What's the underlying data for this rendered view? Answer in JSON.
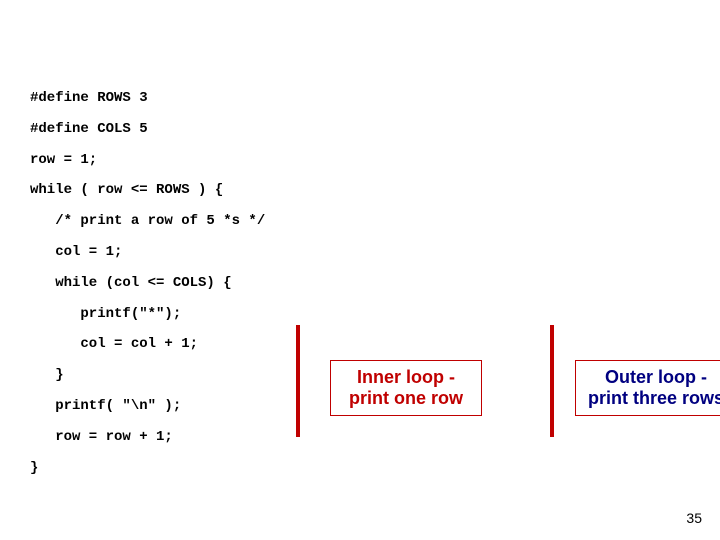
{
  "code": {
    "l1": "#define ROWS 3",
    "l2": "#define COLS 5",
    "l3": "row = 1;",
    "l4": "while ( row <= ROWS ) {",
    "l5": "   /* print a row of 5 *s */",
    "l6": "   col = 1;",
    "l7": "   while (col <= COLS) {",
    "l8": "      printf(\"*\");",
    "l9": "      col = col + 1;",
    "l10": "   }",
    "l11": "   printf( \"\\n\" );",
    "l12": "   row = row + 1;",
    "l13": "}"
  },
  "annotations": {
    "inner": "Inner loop - print one row",
    "outer": "Outer loop - print three rows"
  },
  "page_number": "35"
}
